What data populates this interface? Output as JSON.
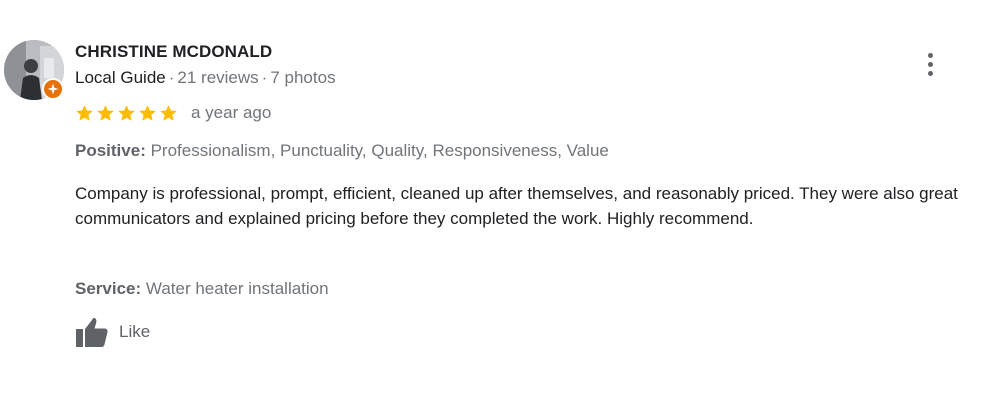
{
  "reviewer": {
    "name": "CHRISTINE MCDONALD",
    "badge": "Local Guide",
    "reviews": "21 reviews",
    "photos": "7 photos",
    "separator": "·"
  },
  "rating": {
    "stars": 5,
    "max": 5,
    "time": "a year ago",
    "star_color": "#fbbc04"
  },
  "positive": {
    "label": "Positive:",
    "value": "Professionalism, Punctuality, Quality, Responsiveness, Value"
  },
  "review_text": "Company is professional, prompt, efficient, cleaned up after themselves, and reasonably priced. They were also great communicators and explained pricing before they completed the work. Highly recommend.",
  "service": {
    "label": "Service:",
    "value": "Water heater installation"
  },
  "actions": {
    "like_label": "Like"
  },
  "icons": {
    "more": "more-vert-icon",
    "like": "thumb-up-icon",
    "badge": "local-guide-icon",
    "star": "star-icon"
  },
  "colors": {
    "badge": "#e8710a",
    "text_primary": "#202124",
    "text_secondary": "#70757a"
  }
}
